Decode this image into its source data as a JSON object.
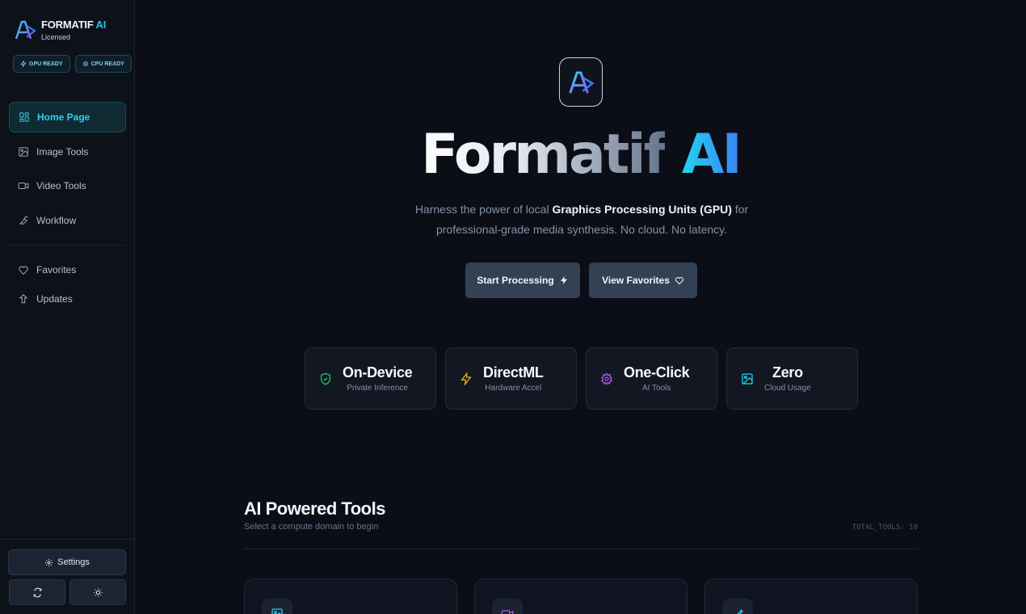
{
  "brand": {
    "name": "FORMATIF",
    "name_accent": "AI",
    "status": "Licensed"
  },
  "badges": [
    {
      "label": "GPU READY",
      "icon": "bolt-icon"
    },
    {
      "label": "CPU READY",
      "icon": "cpu-icon"
    }
  ],
  "nav": {
    "items": [
      {
        "label": "Home Page",
        "icon": "grid-icon",
        "active": true
      },
      {
        "label": "Image Tools",
        "icon": "image-icon"
      },
      {
        "label": "Video Tools",
        "icon": "video-icon"
      },
      {
        "label": "Workflow",
        "icon": "wrench-icon"
      }
    ],
    "secondary": [
      {
        "label": "Favorites",
        "icon": "heart-icon"
      },
      {
        "label": "Updates",
        "icon": "upload-icon"
      }
    ]
  },
  "footer": {
    "settings_label": "Settings"
  },
  "hero": {
    "title_main": "Formatif",
    "title_accent": "AI",
    "desc_before": "Harness the power of local ",
    "desc_bold": "Graphics Processing Units (GPU)",
    "desc_after": " for professional-grade media synthesis. No cloud. No latency.",
    "cta_primary": "Start Processing",
    "cta_secondary": "View Favorites"
  },
  "stats": [
    {
      "value": "On-Device",
      "label": "Private Inference",
      "icon": "shield-check-icon",
      "color": "#22c55e"
    },
    {
      "value": "DirectML",
      "label": "Hardware Accel",
      "icon": "bolt-icon",
      "color": "#eab308"
    },
    {
      "value": "One-Click",
      "label": "AI Tools",
      "icon": "gear-icon",
      "color": "#a855f7"
    },
    {
      "value": "Zero",
      "label": "Cloud Usage",
      "icon": "image-icon",
      "color": "#22d3ee"
    }
  ],
  "tools_section": {
    "title": "AI Powered Tools",
    "subtitle": "Select a compute domain to begin",
    "total": "TOTAL_TOOLS: 10"
  },
  "tool_cards": [
    {
      "icon": "image-icon",
      "color": "#22d3ee"
    },
    {
      "icon": "video-icon",
      "color": "#a855f7"
    },
    {
      "icon": "brush-icon",
      "color": "#22d3ee"
    }
  ]
}
